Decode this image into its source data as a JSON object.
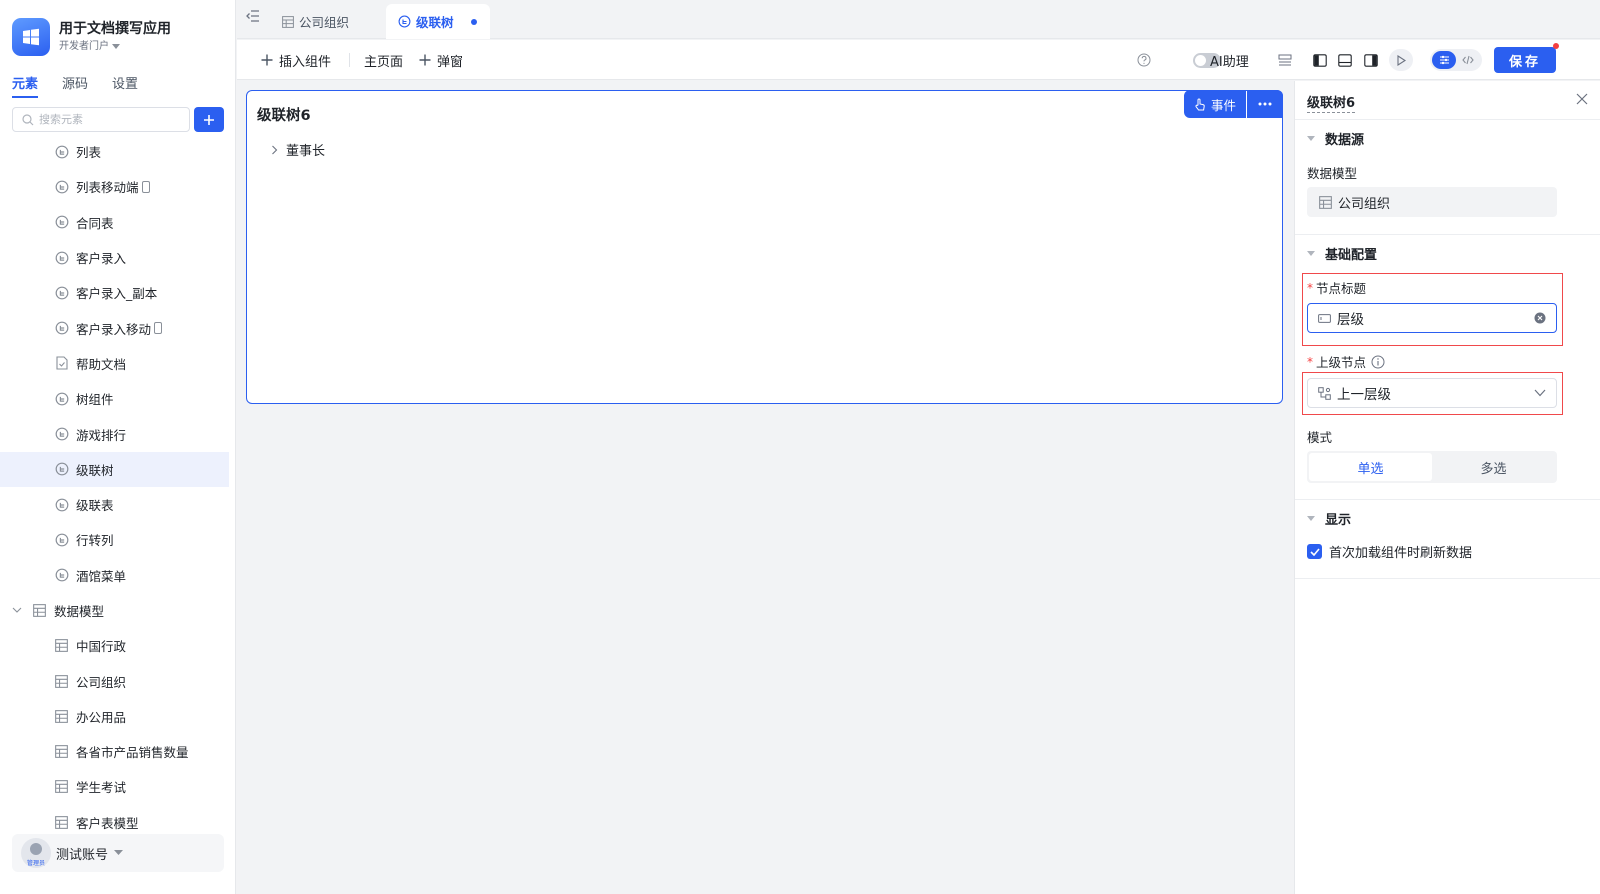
{
  "app": {
    "name": "用于文档撰写应用",
    "portal": "开发者门户"
  },
  "sidebar": {
    "tabs": [
      {
        "label": "元素"
      },
      {
        "label": "源码"
      },
      {
        "label": "设置"
      }
    ],
    "search_placeholder": "搜索元素",
    "items": [
      {
        "label": "列表",
        "icon": "tree-component-icon",
        "mobile": false,
        "selected": false
      },
      {
        "label": "列表移动端",
        "icon": "tree-component-icon",
        "mobile": true,
        "selected": false
      },
      {
        "label": "合同表",
        "icon": "tree-component-icon",
        "mobile": false,
        "selected": false
      },
      {
        "label": "客户录入",
        "icon": "tree-component-icon",
        "mobile": false,
        "selected": false
      },
      {
        "label": "客户录入_副本",
        "icon": "tree-component-icon",
        "mobile": false,
        "selected": false
      },
      {
        "label": "客户录入移动",
        "icon": "tree-component-icon",
        "mobile": true,
        "selected": false
      },
      {
        "label": "帮助文档",
        "icon": "document-icon",
        "mobile": false,
        "selected": false
      },
      {
        "label": "树组件",
        "icon": "tree-component-icon",
        "mobile": false,
        "selected": false
      },
      {
        "label": "游戏排行",
        "icon": "tree-component-icon",
        "mobile": false,
        "selected": false
      },
      {
        "label": "级联树",
        "icon": "tree-component-icon",
        "mobile": false,
        "selected": true
      },
      {
        "label": "级联表",
        "icon": "tree-component-icon",
        "mobile": false,
        "selected": false
      },
      {
        "label": "行转列",
        "icon": "tree-component-icon",
        "mobile": false,
        "selected": false
      },
      {
        "label": "酒馆菜单",
        "icon": "tree-component-icon",
        "mobile": false,
        "selected": false
      }
    ],
    "data_model_group": {
      "label": "数据模型",
      "items": [
        {
          "label": "中国行政"
        },
        {
          "label": "公司组织"
        },
        {
          "label": "办公用品"
        },
        {
          "label": "各省市产品销售数量"
        },
        {
          "label": "学生考试"
        },
        {
          "label": "客户表模型"
        }
      ]
    },
    "account": {
      "name": "测试账号",
      "role": "管理员"
    }
  },
  "tabs": [
    {
      "label": "公司组织",
      "icon": "table-icon",
      "active": false
    },
    {
      "label": "级联树",
      "icon": "tree-component-icon",
      "active": true,
      "unsaved": true
    }
  ],
  "toolbar": {
    "insert_label": "插入组件",
    "home_label": "主页面",
    "popup_label": "弹窗",
    "ai_label": "AI助理",
    "ai_enabled": false,
    "save_label": "保存"
  },
  "canvas": {
    "widget_title": "级联树6",
    "event_label": "事件",
    "tree_nodes": [
      {
        "label": "董事长"
      }
    ]
  },
  "panel": {
    "title": "级联树6",
    "datasource": {
      "heading": "数据源",
      "model_label": "数据模型",
      "model_value": "公司组织"
    },
    "basic": {
      "heading": "基础配置",
      "node_title_label": "节点标题",
      "node_title_value": "层级",
      "parent_label": "上级节点",
      "parent_value": "上一层级",
      "mode_label": "模式",
      "mode_options": [
        {
          "label": "单选"
        },
        {
          "label": "多选"
        }
      ],
      "mode_selected": "单选"
    },
    "display": {
      "heading": "显示",
      "refresh_label": "首次加载组件时刷新数据",
      "refresh_checked": true
    }
  },
  "colors": {
    "accent": "#2b5ff0",
    "highlight": "#f0494b",
    "required": "#f53f3f"
  }
}
